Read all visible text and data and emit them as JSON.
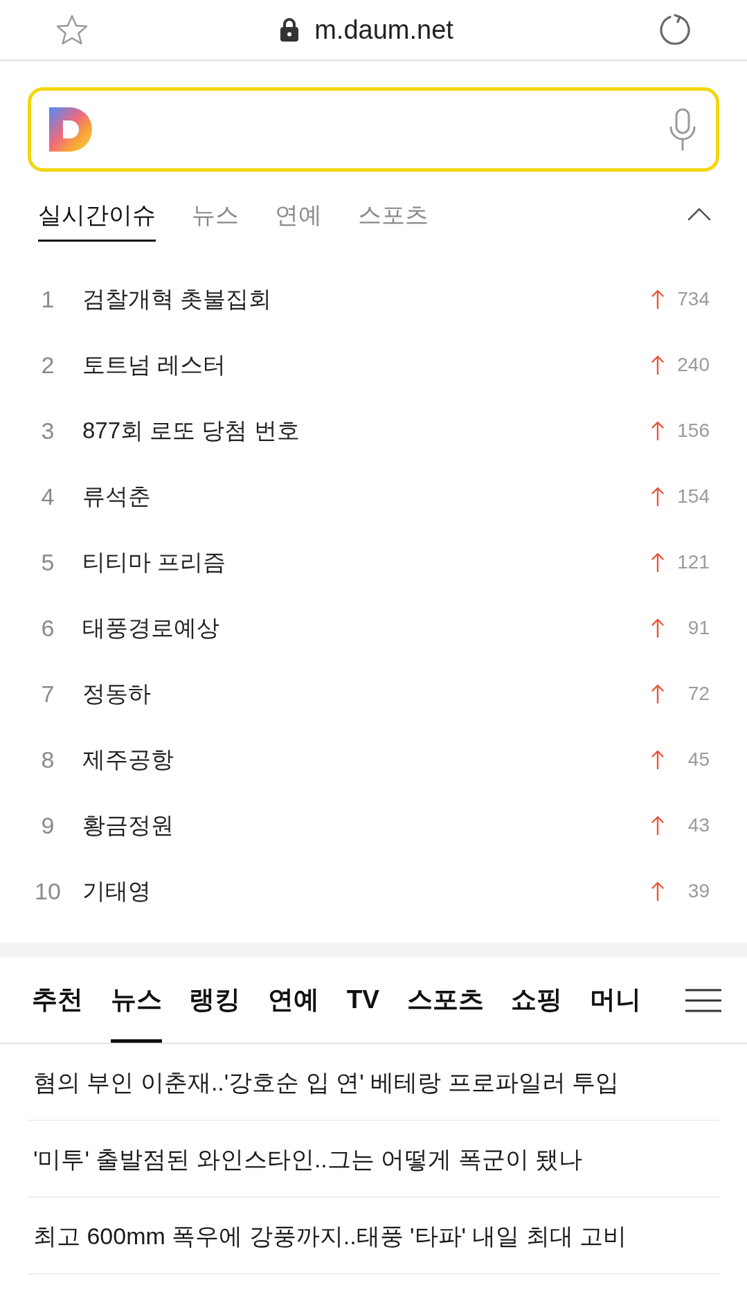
{
  "address_bar": {
    "url": "m.daum.net",
    "secure": true,
    "bookmarked": false
  },
  "issue_tabs": {
    "expanded": true,
    "tabs": [
      {
        "label": "실시간이슈",
        "selected": true
      },
      {
        "label": "뉴스",
        "selected": false
      },
      {
        "label": "연예",
        "selected": false
      },
      {
        "label": "스포츠",
        "selected": false
      }
    ]
  },
  "trending": [
    {
      "rank": "1",
      "keyword": "검찰개혁 촛불집회",
      "rising": true,
      "change": "734"
    },
    {
      "rank": "2",
      "keyword": "토트넘 레스터",
      "rising": true,
      "change": "240"
    },
    {
      "rank": "3",
      "keyword": "877회 로또 당첨 번호",
      "rising": true,
      "change": "156"
    },
    {
      "rank": "4",
      "keyword": "류석춘",
      "rising": true,
      "change": "154"
    },
    {
      "rank": "5",
      "keyword": "티티마 프리즘",
      "rising": true,
      "change": "121"
    },
    {
      "rank": "6",
      "keyword": "태풍경로예상",
      "rising": true,
      "change": "91"
    },
    {
      "rank": "7",
      "keyword": "정동하",
      "rising": true,
      "change": "72"
    },
    {
      "rank": "8",
      "keyword": "제주공항",
      "rising": true,
      "change": "45"
    },
    {
      "rank": "9",
      "keyword": "황금정원",
      "rising": true,
      "change": "43"
    },
    {
      "rank": "10",
      "keyword": "기태영",
      "rising": true,
      "change": "39"
    }
  ],
  "nav_tabs": [
    {
      "label": "추천",
      "selected": false
    },
    {
      "label": "뉴스",
      "selected": true
    },
    {
      "label": "랭킹",
      "selected": false
    },
    {
      "label": "연예",
      "selected": false
    },
    {
      "label": "TV",
      "selected": false
    },
    {
      "label": "스포츠",
      "selected": false
    },
    {
      "label": "쇼핑",
      "selected": false
    },
    {
      "label": "머니",
      "selected": false
    }
  ],
  "news": [
    {
      "headline": "혐의 부인 이춘재..'강호순 입 연' 베테랑 프로파일러 투입"
    },
    {
      "headline": "'미투' 출발점된 와인스타인..그는 어떻게 폭군이 됐나"
    },
    {
      "headline": "최고 600mm 폭우에 강풍까지..태풍 '타파' 내일 최대 고비"
    }
  ]
}
